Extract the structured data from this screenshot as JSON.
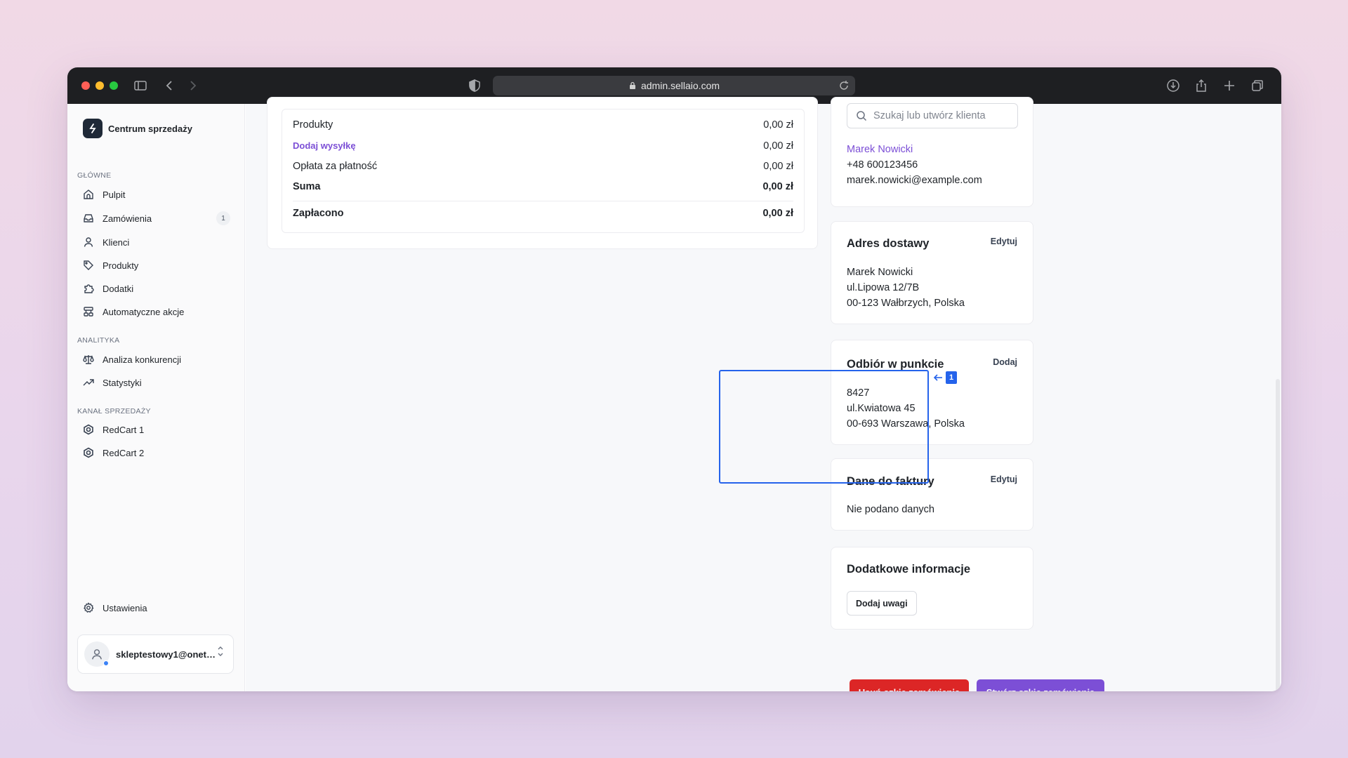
{
  "browser": {
    "url": "admin.sellaio.com"
  },
  "sidebar": {
    "brand": "Centrum sprzedaży",
    "sections": {
      "main": "GŁÓWNE",
      "analytics": "ANALITYKA",
      "channel": "KANAŁ SPRZEDAŻY"
    },
    "items": [
      {
        "label": "Pulpit",
        "icon": "home-icon"
      },
      {
        "label": "Zamówienia",
        "icon": "inbox-icon",
        "badge": "1"
      },
      {
        "label": "Klienci",
        "icon": "user-icon"
      },
      {
        "label": "Produkty",
        "icon": "tag-icon"
      },
      {
        "label": "Dodatki",
        "icon": "puzzle-icon"
      },
      {
        "label": "Automatyczne akcje",
        "icon": "workflow-icon"
      },
      {
        "label": "Analiza konkurencji",
        "icon": "scale-icon"
      },
      {
        "label": "Statystyki",
        "icon": "trending-up-icon"
      },
      {
        "label": "RedCart 1",
        "icon": "hexagon-logo-icon"
      },
      {
        "label": "RedCart 2",
        "icon": "hexagon-logo-icon"
      }
    ],
    "settings": "Ustawienia",
    "account_email": "skleptestowy1@onet.pl"
  },
  "summary": {
    "products_label": "Produkty",
    "products_value": "0,00 zł",
    "shipping_label": "Dodaj wysyłkę",
    "shipping_value": "0,00 zł",
    "payment_fee_label": "Opłata za płatność",
    "payment_fee_value": "0,00 zł",
    "total_label": "Suma",
    "total_value": "0,00 zł",
    "paid_label": "Zapłacono",
    "paid_value": "0,00 zł"
  },
  "customer": {
    "search_placeholder": "Szukaj lub utwórz klienta",
    "name": "Marek Nowicki",
    "phone": "+48 600123456",
    "email": "marek.nowicki@example.com"
  },
  "shipping_address": {
    "title": "Adres dostawy",
    "action": "Edytuj",
    "name": "Marek Nowicki",
    "street": "ul.Lipowa 12/7B",
    "city": "00-123 Wałbrzych, Polska"
  },
  "pickup": {
    "title": "Odbiór w punkcie",
    "action": "Dodaj",
    "code": "8427",
    "street": "ul.Kwiatowa 45",
    "city": "00-693 Warszawa, Polska",
    "marker": "1"
  },
  "invoice": {
    "title": "Dane do faktury",
    "action": "Edytuj",
    "empty": "Nie podano danych"
  },
  "extra": {
    "title": "Dodatkowe informacje",
    "button": "Dodaj uwagi"
  },
  "actions": {
    "delete": "Usuń szkic zamówienia",
    "create": "Stwórz szkic zamówienia"
  },
  "colors": {
    "accent": "#7c4fd6",
    "danger": "#dc2626",
    "highlight": "#2563eb"
  }
}
